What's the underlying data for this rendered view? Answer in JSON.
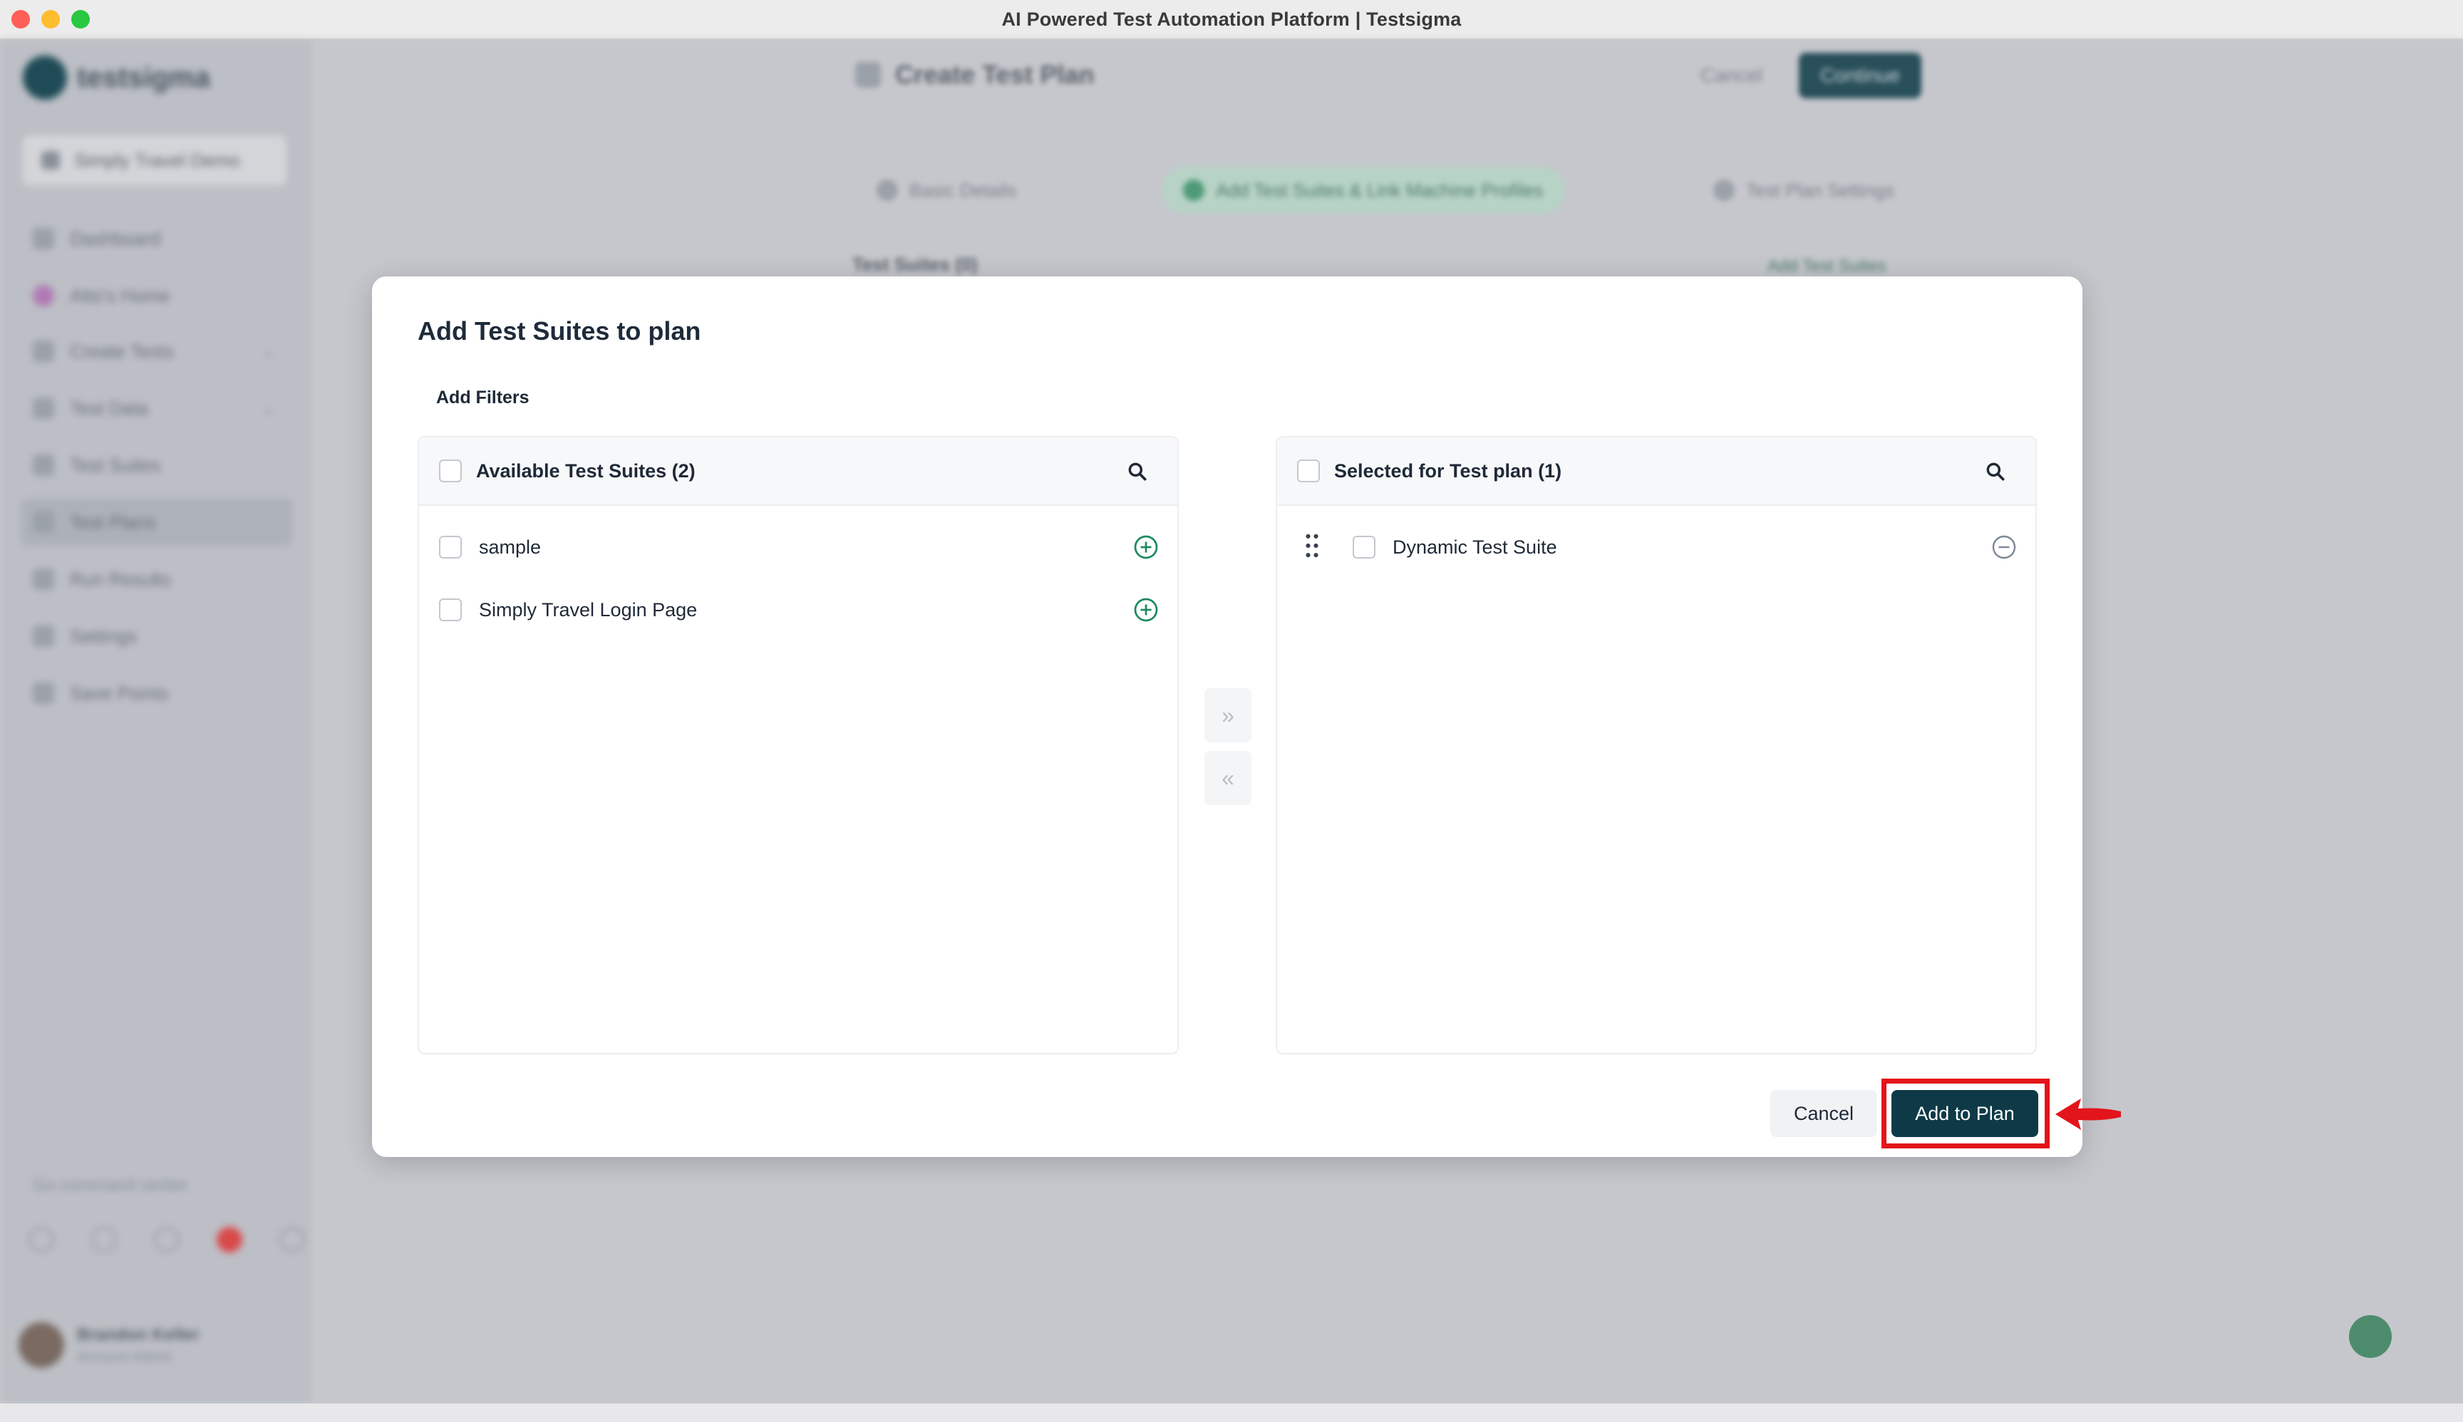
{
  "window": {
    "title": "AI Powered Test Automation Platform | Testsigma"
  },
  "background": {
    "sidebar": {
      "brand": "testsigma",
      "project": "Simply Travel Demo",
      "items": [
        {
          "label": "Dashboard"
        },
        {
          "label": "Atto's Home"
        },
        {
          "label": "Create Tests"
        },
        {
          "label": "Test Data"
        },
        {
          "label": "Test Suites"
        },
        {
          "label": "Test Plans"
        },
        {
          "label": "Run Results"
        },
        {
          "label": "Settings"
        },
        {
          "label": "Save Points"
        }
      ],
      "command_center": "Go command center",
      "user": {
        "name": "Brandon Keller",
        "sub": "Account Admin"
      }
    },
    "header": {
      "title": "Create Test Plan",
      "cancel": "Cancel",
      "continue": "Continue"
    },
    "steps": [
      {
        "label": "Basic Details"
      },
      {
        "label": "Add Test Suites & Link Machine Profiles"
      },
      {
        "label": "Test Plan Settings"
      }
    ],
    "section_title": "Test Suites (0)",
    "section_link": "Add Test Suites"
  },
  "modal": {
    "title": "Add Test Suites to plan",
    "add_filters": "Add Filters",
    "available": {
      "header": "Available Test Suites (2)",
      "items": [
        {
          "label": "sample"
        },
        {
          "label": "Simply Travel Login Page"
        }
      ]
    },
    "selected": {
      "header": "Selected for Test plan (1)",
      "items": [
        {
          "label": "Dynamic Test Suite"
        }
      ]
    },
    "move_right": "»",
    "move_left": "«",
    "cancel": "Cancel",
    "add_to_plan": "Add to Plan"
  },
  "colors": {
    "primary": "#0e3a47",
    "add_icon": "#1a8a5c",
    "highlight": "#e3141b"
  }
}
